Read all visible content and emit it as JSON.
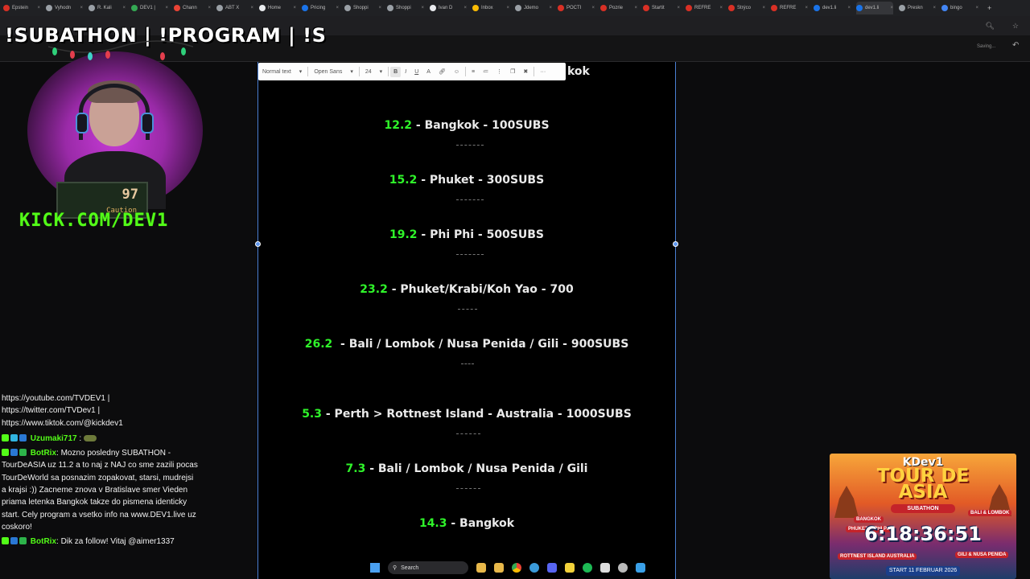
{
  "browser": {
    "tabs": [
      {
        "label": "Epstein",
        "color": "#d93025"
      },
      {
        "label": "Vyhodn",
        "color": "#9aa0a6"
      },
      {
        "label": "R. Kali",
        "color": "#9aa0a6"
      },
      {
        "label": "DEV1 |",
        "color": "#34a853"
      },
      {
        "label": "Chann",
        "color": "#ea4335"
      },
      {
        "label": "ABT X",
        "color": "#9aa0a6"
      },
      {
        "label": "Home",
        "color": "#e8eaed"
      },
      {
        "label": "Pricing",
        "color": "#1a73e8"
      },
      {
        "label": "Shoppi",
        "color": "#9aa0a6"
      },
      {
        "label": "Shoppi",
        "color": "#9aa0a6"
      },
      {
        "label": "Ivan D",
        "color": "#e8eaed"
      },
      {
        "label": "Inbox",
        "color": "#fbbc04"
      },
      {
        "label": "Jdemo",
        "color": "#9aa0a6"
      },
      {
        "label": "POCTI",
        "color": "#d93025"
      },
      {
        "label": "Pozrie",
        "color": "#d93025"
      },
      {
        "label": "Startit",
        "color": "#d93025"
      },
      {
        "label": "REFRE",
        "color": "#d93025"
      },
      {
        "label": "Strýco",
        "color": "#d93025"
      },
      {
        "label": "REFRE",
        "color": "#d93025"
      },
      {
        "label": "dev1.li",
        "color": "#1a73e8"
      },
      {
        "label": "dev1.li",
        "color": "#1a73e8",
        "active": true
      },
      {
        "label": "Preskn",
        "color": "#9aa0a6"
      },
      {
        "label": "bingo",
        "color": "#4285f4"
      }
    ],
    "new_tab": "+"
  },
  "docs": {
    "saving_label": "Saving...",
    "formatting": {
      "style": "Normal text",
      "font": "Open Sans",
      "size": "24",
      "bold": "B",
      "italic": "I",
      "underline": "U",
      "text_color": "A",
      "more": "···"
    },
    "top_fragment": "kok",
    "entries": [
      {
        "date": "12.2",
        "text": " - Bangkok - 100SUBS"
      },
      {
        "date": "15.2",
        "text": " - Phuket - 300SUBS"
      },
      {
        "date": "19.2",
        "text": " - Phi Phi - 500SUBS"
      },
      {
        "date": "23.2",
        "text": " - Phuket/Krabi/Koh Yao - 700"
      },
      {
        "date": "26.2",
        "text": "  - Bali / Lombok / Nusa Penida / Gili - 900SUBS"
      },
      {
        "date": "5.3",
        "text": " - Perth > Rottnest Island - Australia - 1000SUBS"
      },
      {
        "date": "7.3",
        "text": " - Bali / Lombok / Nusa Penida / Gili"
      },
      {
        "date": "14.3",
        "text": " - Bangkok"
      }
    ]
  },
  "stream": {
    "title": "!SUBATHON | !PROGRAM | !S",
    "caution_value": "97",
    "caution_label": "Caution",
    "kick_url": "KICK.COM/DEV1"
  },
  "chat": {
    "lines": [
      "https://youtube.com/TVDEV1 |",
      "https://twitter.com/TVDev1 |",
      "https://www.tiktok.com/@kickdev1"
    ],
    "user1": "Uzumaki717",
    "botrix1_name": "BotRix",
    "botrix1_text": ": Mozno posledny SUBATHON - TourDeASIA uz 11.2 a to naj z NAJ co sme zazili pocas TourDeWorld sa posnazim zopakovat, starsi, mudrejsi a krajsi :)) Zacneme znova v Bratislave smer Vieden priama letenka Bangkok takze do pismena identicky start. Cely program a vsetko info na www.DEV1.live uz coskoro!",
    "botrix2_name": "BotRix",
    "botrix2_text": ": Dik za follow! Vitaj @aimer1337"
  },
  "promo": {
    "brand": "KDev1",
    "title_line1": "TOUR DE",
    "title_line2": "ASIA",
    "subtitle": "SUBATHON",
    "tags": [
      "BANGKOK",
      "PHUKET & PHI PHI",
      "BALI & LOMBOK",
      "ROTTNEST ISLAND AUSTRALIA",
      "GILI & NUSA PENIDA"
    ],
    "timer": "6:18:36:51",
    "start": "START 11 FEBRUAR 2026"
  },
  "taskbar": {
    "search_label": "Search",
    "icons": [
      "file-explorer",
      "chrome",
      "edge",
      "discord",
      "sticky",
      "spotify",
      "notepad",
      "settings",
      "app"
    ],
    "icon_colors": [
      "#e8b84a",
      "#e8b84a",
      "#3a9ad9",
      "#5865f2",
      "#f2d13a",
      "#1db954",
      "#dddddd",
      "#bbbbbb",
      "#3aa0e8"
    ]
  },
  "colors": {
    "accent_green": "#2ff42a",
    "kick_green": "#53fc18",
    "selection_blue": "#4b7fd3"
  }
}
